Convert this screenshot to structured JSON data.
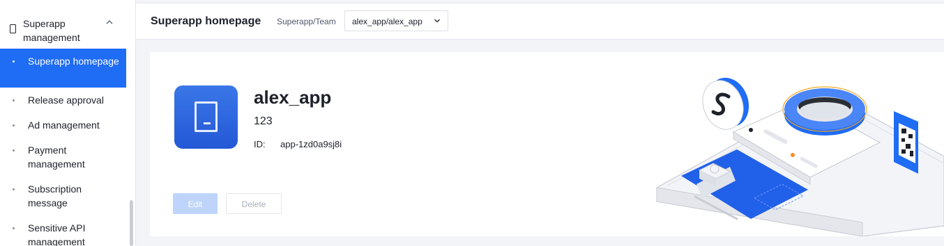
{
  "sidebar": {
    "group_title": "Superapp management",
    "items": [
      {
        "label": "Superapp homepage",
        "active": true
      },
      {
        "label": "Release approval",
        "active": false
      },
      {
        "label": "Ad management",
        "active": false
      },
      {
        "label": "Payment management",
        "active": false
      },
      {
        "label": "Subscription message",
        "active": false
      },
      {
        "label": "Sensitive API management",
        "active": false
      }
    ]
  },
  "header": {
    "title": "Superapp homepage",
    "selector_label": "Superapp/Team",
    "selector_value": "alex_app/alex_app"
  },
  "app": {
    "name": "alex_app",
    "description": "123",
    "id_label": "ID:",
    "id_value": "app-1zd0a9sj8i",
    "edit_label": "Edit",
    "delete_label": "Delete"
  },
  "colors": {
    "accent": "#1f6cf5",
    "edit_disabled": "#bed4fb"
  },
  "icons": {
    "group": "phone-icon",
    "group_toggle": "chevron-up-icon",
    "selector": "chevron-down-icon",
    "app_logo": "miniapp-logo-icon"
  }
}
